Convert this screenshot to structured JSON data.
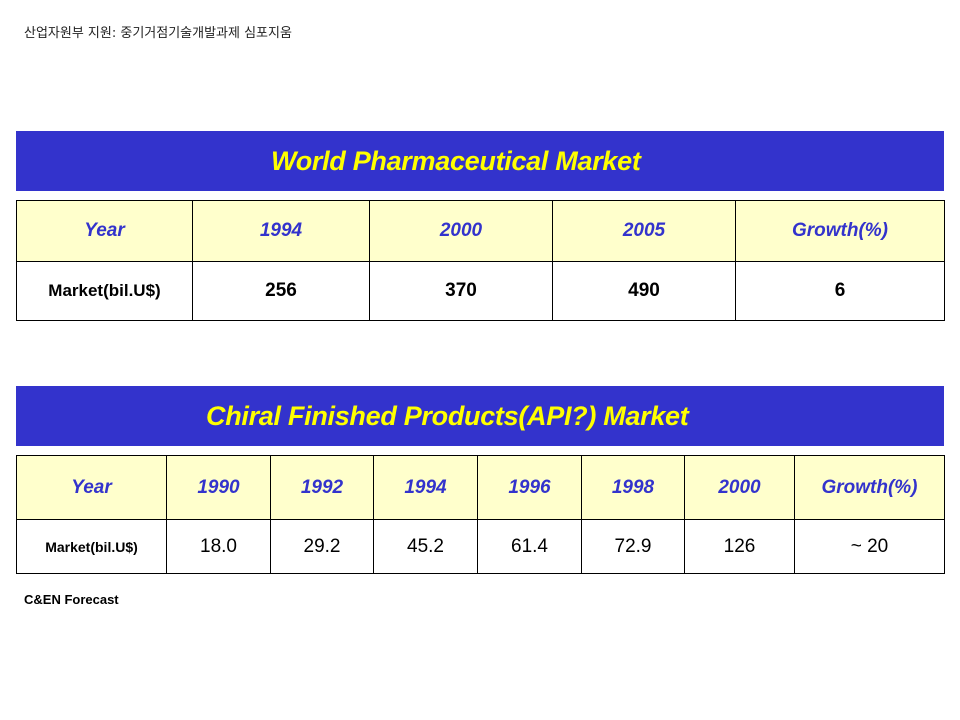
{
  "top_note": "산업자원부 지원: 중기거점기술개발과제 심포지움",
  "world_market": {
    "title": "World Pharmaceutical Market",
    "header": [
      "Year",
      "1994",
      "2000",
      "2005",
      "Growth(%)"
    ],
    "row": [
      "Market(bil.U$)",
      "256",
      "370",
      "490",
      "6"
    ]
  },
  "chiral_market": {
    "title": "Chiral Finished Products(API?) Market",
    "header": [
      "Year",
      "1990",
      "1992",
      "1994",
      "1996",
      "1998",
      "2000",
      "Growth(%)"
    ],
    "row": [
      "Market(bil.U$)",
      "18.0",
      "29.2",
      "45.2",
      "61.4",
      "72.9",
      "126",
      "~ 20"
    ]
  },
  "source": "C&EN Forecast",
  "colors": {
    "banner_bg": "#3333cc",
    "banner_text": "#ffff00",
    "header_bg": "#ffffcc",
    "header_text": "#3333cc"
  }
}
